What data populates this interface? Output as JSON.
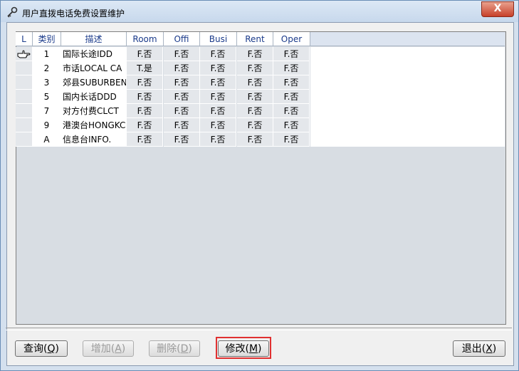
{
  "window": {
    "title": "用户直拨电话免费设置维护",
    "close_label": "X"
  },
  "grid": {
    "headers": [
      "L",
      "类别",
      "描述",
      "Room",
      "Offi",
      "Busi",
      "Rent",
      "Oper"
    ],
    "rows": [
      {
        "code": "1",
        "desc": "国际长途IDD",
        "flags": [
          "F.否",
          "F.否",
          "F.否",
          "F.否",
          "F.否"
        ],
        "current": true
      },
      {
        "code": "2",
        "desc": "市话LOCAL CA",
        "flags": [
          "T.是",
          "F.否",
          "F.否",
          "F.否",
          "F.否"
        ]
      },
      {
        "code": "3",
        "desc": "郊县SUBURBEN",
        "flags": [
          "F.否",
          "F.否",
          "F.否",
          "F.否",
          "F.否"
        ]
      },
      {
        "code": "5",
        "desc": "国内长话DDD",
        "flags": [
          "F.否",
          "F.否",
          "F.否",
          "F.否",
          "F.否"
        ]
      },
      {
        "code": "7",
        "desc": "对方付费CLCT",
        "flags": [
          "F.否",
          "F.否",
          "F.否",
          "F.否",
          "F.否"
        ]
      },
      {
        "code": "9",
        "desc": "港澳台HONGKC",
        "flags": [
          "F.否",
          "F.否",
          "F.否",
          "F.否",
          "F.否"
        ]
      },
      {
        "code": "A",
        "desc": "信息台INFO.",
        "flags": [
          "F.否",
          "F.否",
          "F.否",
          "F.否",
          "F.否"
        ]
      }
    ]
  },
  "buttons": {
    "query": {
      "label": "查询",
      "key": "Q"
    },
    "add": {
      "label": "增加",
      "key": "A"
    },
    "delete": {
      "label": "删除",
      "key": "D"
    },
    "modify": {
      "label": "修改",
      "key": "M"
    },
    "exit": {
      "label": "退出",
      "key": "X"
    }
  },
  "colors": {
    "header_text": "#1a3a8a",
    "highlight": "#e03030",
    "close_button": "#c7402a"
  }
}
